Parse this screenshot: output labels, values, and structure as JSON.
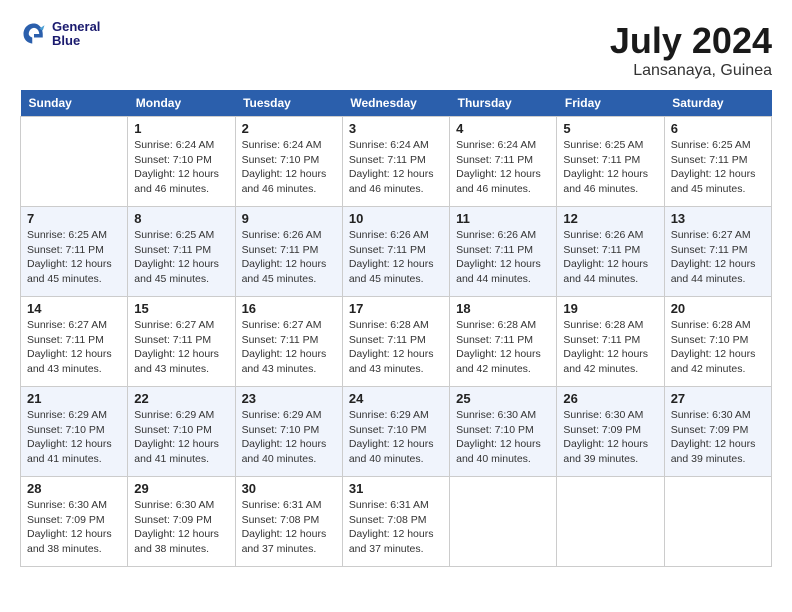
{
  "header": {
    "logo_line1": "General",
    "logo_line2": "Blue",
    "month": "July 2024",
    "location": "Lansanaya, Guinea"
  },
  "weekdays": [
    "Sunday",
    "Monday",
    "Tuesday",
    "Wednesday",
    "Thursday",
    "Friday",
    "Saturday"
  ],
  "weeks": [
    [
      {
        "day": "",
        "sunrise": "",
        "sunset": "",
        "daylight": ""
      },
      {
        "day": "1",
        "sunrise": "Sunrise: 6:24 AM",
        "sunset": "Sunset: 7:10 PM",
        "daylight": "Daylight: 12 hours and 46 minutes."
      },
      {
        "day": "2",
        "sunrise": "Sunrise: 6:24 AM",
        "sunset": "Sunset: 7:10 PM",
        "daylight": "Daylight: 12 hours and 46 minutes."
      },
      {
        "day": "3",
        "sunrise": "Sunrise: 6:24 AM",
        "sunset": "Sunset: 7:11 PM",
        "daylight": "Daylight: 12 hours and 46 minutes."
      },
      {
        "day": "4",
        "sunrise": "Sunrise: 6:24 AM",
        "sunset": "Sunset: 7:11 PM",
        "daylight": "Daylight: 12 hours and 46 minutes."
      },
      {
        "day": "5",
        "sunrise": "Sunrise: 6:25 AM",
        "sunset": "Sunset: 7:11 PM",
        "daylight": "Daylight: 12 hours and 46 minutes."
      },
      {
        "day": "6",
        "sunrise": "Sunrise: 6:25 AM",
        "sunset": "Sunset: 7:11 PM",
        "daylight": "Daylight: 12 hours and 45 minutes."
      }
    ],
    [
      {
        "day": "7",
        "sunrise": "Sunrise: 6:25 AM",
        "sunset": "Sunset: 7:11 PM",
        "daylight": "Daylight: 12 hours and 45 minutes."
      },
      {
        "day": "8",
        "sunrise": "Sunrise: 6:25 AM",
        "sunset": "Sunset: 7:11 PM",
        "daylight": "Daylight: 12 hours and 45 minutes."
      },
      {
        "day": "9",
        "sunrise": "Sunrise: 6:26 AM",
        "sunset": "Sunset: 7:11 PM",
        "daylight": "Daylight: 12 hours and 45 minutes."
      },
      {
        "day": "10",
        "sunrise": "Sunrise: 6:26 AM",
        "sunset": "Sunset: 7:11 PM",
        "daylight": "Daylight: 12 hours and 45 minutes."
      },
      {
        "day": "11",
        "sunrise": "Sunrise: 6:26 AM",
        "sunset": "Sunset: 7:11 PM",
        "daylight": "Daylight: 12 hours and 44 minutes."
      },
      {
        "day": "12",
        "sunrise": "Sunrise: 6:26 AM",
        "sunset": "Sunset: 7:11 PM",
        "daylight": "Daylight: 12 hours and 44 minutes."
      },
      {
        "day": "13",
        "sunrise": "Sunrise: 6:27 AM",
        "sunset": "Sunset: 7:11 PM",
        "daylight": "Daylight: 12 hours and 44 minutes."
      }
    ],
    [
      {
        "day": "14",
        "sunrise": "Sunrise: 6:27 AM",
        "sunset": "Sunset: 7:11 PM",
        "daylight": "Daylight: 12 hours and 43 minutes."
      },
      {
        "day": "15",
        "sunrise": "Sunrise: 6:27 AM",
        "sunset": "Sunset: 7:11 PM",
        "daylight": "Daylight: 12 hours and 43 minutes."
      },
      {
        "day": "16",
        "sunrise": "Sunrise: 6:27 AM",
        "sunset": "Sunset: 7:11 PM",
        "daylight": "Daylight: 12 hours and 43 minutes."
      },
      {
        "day": "17",
        "sunrise": "Sunrise: 6:28 AM",
        "sunset": "Sunset: 7:11 PM",
        "daylight": "Daylight: 12 hours and 43 minutes."
      },
      {
        "day": "18",
        "sunrise": "Sunrise: 6:28 AM",
        "sunset": "Sunset: 7:11 PM",
        "daylight": "Daylight: 12 hours and 42 minutes."
      },
      {
        "day": "19",
        "sunrise": "Sunrise: 6:28 AM",
        "sunset": "Sunset: 7:11 PM",
        "daylight": "Daylight: 12 hours and 42 minutes."
      },
      {
        "day": "20",
        "sunrise": "Sunrise: 6:28 AM",
        "sunset": "Sunset: 7:10 PM",
        "daylight": "Daylight: 12 hours and 42 minutes."
      }
    ],
    [
      {
        "day": "21",
        "sunrise": "Sunrise: 6:29 AM",
        "sunset": "Sunset: 7:10 PM",
        "daylight": "Daylight: 12 hours and 41 minutes."
      },
      {
        "day": "22",
        "sunrise": "Sunrise: 6:29 AM",
        "sunset": "Sunset: 7:10 PM",
        "daylight": "Daylight: 12 hours and 41 minutes."
      },
      {
        "day": "23",
        "sunrise": "Sunrise: 6:29 AM",
        "sunset": "Sunset: 7:10 PM",
        "daylight": "Daylight: 12 hours and 40 minutes."
      },
      {
        "day": "24",
        "sunrise": "Sunrise: 6:29 AM",
        "sunset": "Sunset: 7:10 PM",
        "daylight": "Daylight: 12 hours and 40 minutes."
      },
      {
        "day": "25",
        "sunrise": "Sunrise: 6:30 AM",
        "sunset": "Sunset: 7:10 PM",
        "daylight": "Daylight: 12 hours and 40 minutes."
      },
      {
        "day": "26",
        "sunrise": "Sunrise: 6:30 AM",
        "sunset": "Sunset: 7:09 PM",
        "daylight": "Daylight: 12 hours and 39 minutes."
      },
      {
        "day": "27",
        "sunrise": "Sunrise: 6:30 AM",
        "sunset": "Sunset: 7:09 PM",
        "daylight": "Daylight: 12 hours and 39 minutes."
      }
    ],
    [
      {
        "day": "28",
        "sunrise": "Sunrise: 6:30 AM",
        "sunset": "Sunset: 7:09 PM",
        "daylight": "Daylight: 12 hours and 38 minutes."
      },
      {
        "day": "29",
        "sunrise": "Sunrise: 6:30 AM",
        "sunset": "Sunset: 7:09 PM",
        "daylight": "Daylight: 12 hours and 38 minutes."
      },
      {
        "day": "30",
        "sunrise": "Sunrise: 6:31 AM",
        "sunset": "Sunset: 7:08 PM",
        "daylight": "Daylight: 12 hours and 37 minutes."
      },
      {
        "day": "31",
        "sunrise": "Sunrise: 6:31 AM",
        "sunset": "Sunset: 7:08 PM",
        "daylight": "Daylight: 12 hours and 37 minutes."
      },
      {
        "day": "",
        "sunrise": "",
        "sunset": "",
        "daylight": ""
      },
      {
        "day": "",
        "sunrise": "",
        "sunset": "",
        "daylight": ""
      },
      {
        "day": "",
        "sunrise": "",
        "sunset": "",
        "daylight": ""
      }
    ]
  ]
}
